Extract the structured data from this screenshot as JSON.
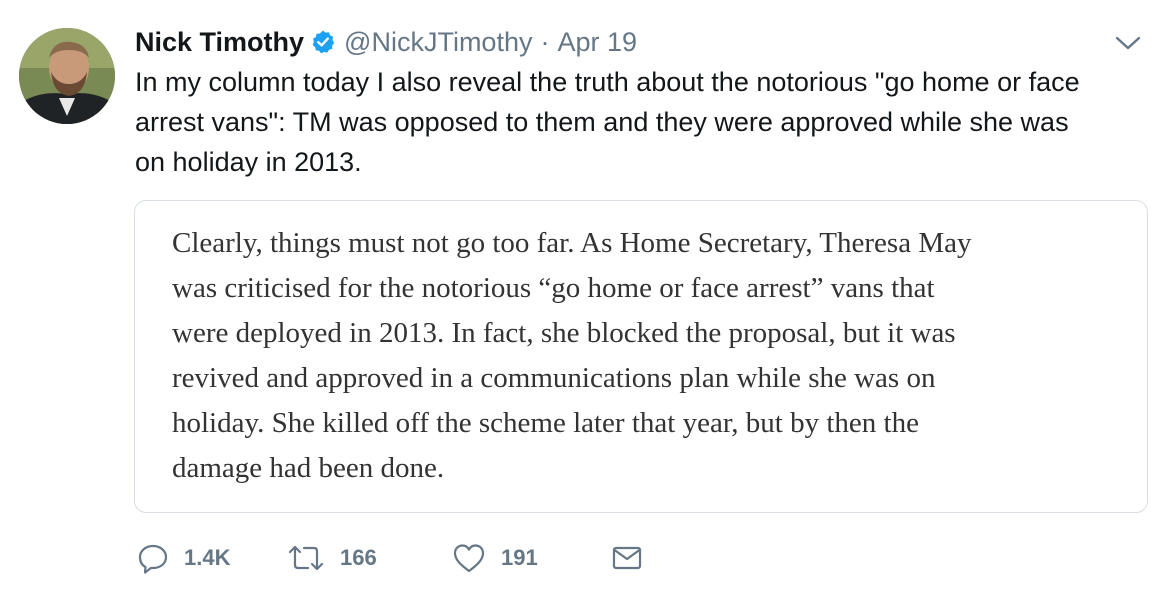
{
  "author": {
    "name": "Nick Timothy",
    "handle": "@NickJTimothy",
    "separator": "·",
    "date": "Apr 19",
    "verified": true
  },
  "tweet": {
    "text": "In my column today I also reveal the truth about the notorious \"go home or face\narrest vans\": TM was opposed to them and they were approved while she was\non holiday in 2013."
  },
  "quote": {
    "text": "Clearly, things must not go too far. As Home Secretary, Theresa May\nwas criticised for the notorious “go home or face arrest” vans that\nwere deployed in 2013. In fact, she blocked the proposal, but it was\nrevived and approved in a communications plan while she was on\nholiday. She killed off the scheme later that year, but by then the\ndamage had been done."
  },
  "actions": {
    "reply_count": "1.4K",
    "retweet_count": "166",
    "like_count": "191"
  },
  "icons": {
    "verified": "verified-badge-icon",
    "menu": "chevron-down-icon",
    "reply": "reply-icon",
    "retweet": "retweet-icon",
    "like": "heart-icon",
    "message": "envelope-icon"
  },
  "colors": {
    "text_primary": "#14171a",
    "text_secondary": "#657786",
    "verified_blue": "#1da1f2",
    "card_border": "#d8dee3"
  }
}
